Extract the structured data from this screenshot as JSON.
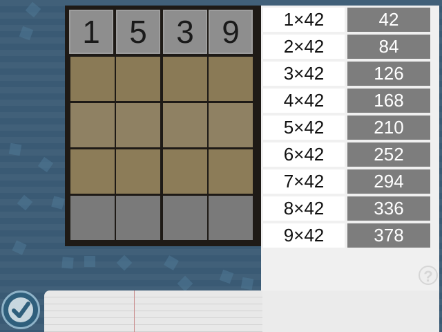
{
  "board": {
    "digits": [
      "1",
      "5",
      "3",
      "9"
    ]
  },
  "multiplication_table": {
    "rows": [
      {
        "expr": "1×42",
        "result": "42"
      },
      {
        "expr": "2×42",
        "result": "84"
      },
      {
        "expr": "3×42",
        "result": "126"
      },
      {
        "expr": "4×42",
        "result": "168"
      },
      {
        "expr": "5×42",
        "result": "210"
      },
      {
        "expr": "6×42",
        "result": "252"
      },
      {
        "expr": "7×42",
        "result": "294"
      },
      {
        "expr": "8×42",
        "result": "336"
      },
      {
        "expr": "9×42",
        "result": "378"
      }
    ]
  },
  "help": {
    "label": "?"
  },
  "colors": {
    "background": "#3a5a74",
    "board_frame": "#1e1a16",
    "digit_tile": "#8e8e8e",
    "answer_tile": "#8a7a56",
    "empty_tile": "#7a7a7a",
    "result_cell": "#7d7d7d"
  },
  "icons": {
    "submit": "check-icon",
    "help": "question-icon"
  }
}
